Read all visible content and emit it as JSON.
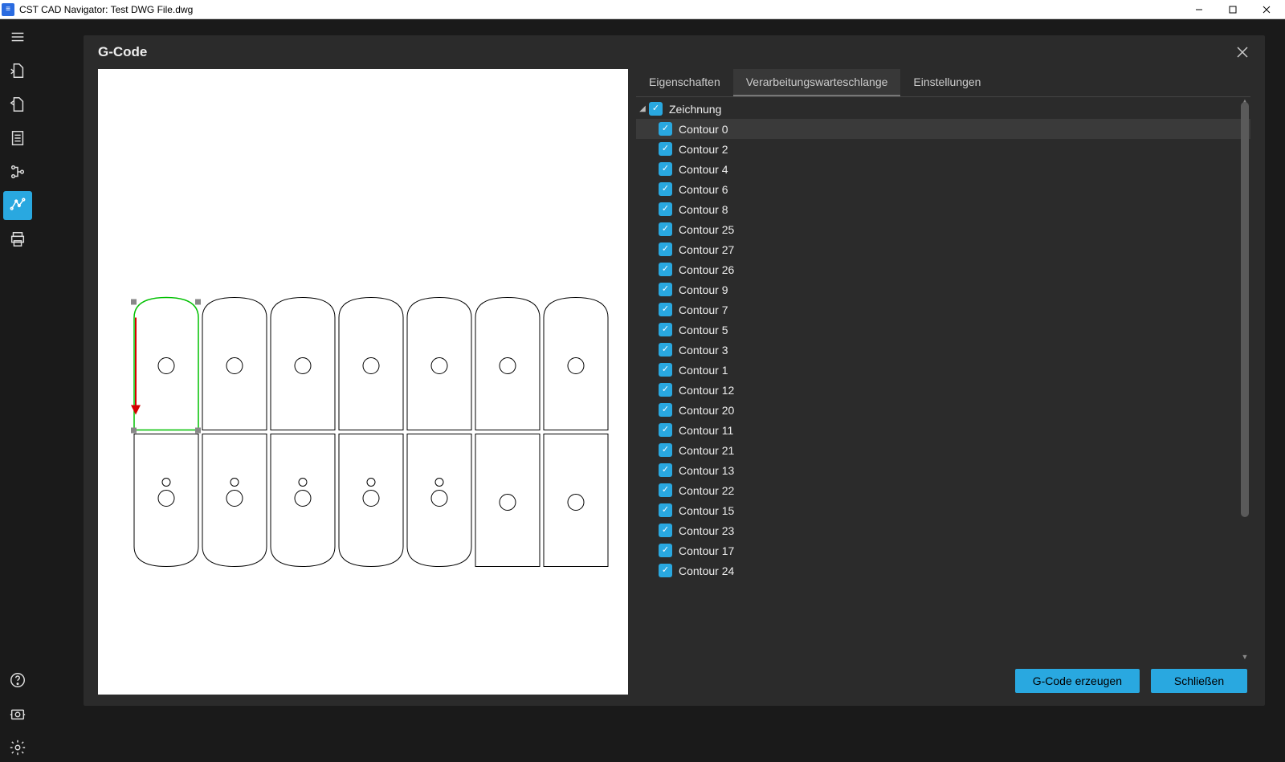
{
  "window": {
    "title": "CST CAD Navigator: Test DWG File.dwg"
  },
  "modal": {
    "title": "G-Code",
    "tabs": [
      {
        "id": "props",
        "label": "Eigenschaften",
        "active": false
      },
      {
        "id": "queue",
        "label": "Verarbeitungswarteschlange",
        "active": true
      },
      {
        "id": "settings",
        "label": "Einstellungen",
        "active": false
      }
    ],
    "tree_root": {
      "label": "Zeichnung",
      "expanded": true,
      "checked": true
    },
    "contours": [
      {
        "label": "Contour 0",
        "selected": true
      },
      {
        "label": "Contour 2"
      },
      {
        "label": "Contour 4"
      },
      {
        "label": "Contour 6"
      },
      {
        "label": "Contour 8"
      },
      {
        "label": "Contour 25"
      },
      {
        "label": "Contour 27"
      },
      {
        "label": "Contour 26"
      },
      {
        "label": "Contour 9"
      },
      {
        "label": "Contour 7"
      },
      {
        "label": "Contour 5"
      },
      {
        "label": "Contour 3"
      },
      {
        "label": "Contour 1"
      },
      {
        "label": "Contour 12"
      },
      {
        "label": "Contour 20"
      },
      {
        "label": "Contour 11"
      },
      {
        "label": "Contour 21"
      },
      {
        "label": "Contour 13"
      },
      {
        "label": "Contour 22"
      },
      {
        "label": "Contour 15"
      },
      {
        "label": "Contour 23"
      },
      {
        "label": "Contour 17"
      },
      {
        "label": "Contour 24"
      }
    ],
    "buttons": {
      "generate": "G-Code erzeugen",
      "close": "Schließen"
    }
  }
}
